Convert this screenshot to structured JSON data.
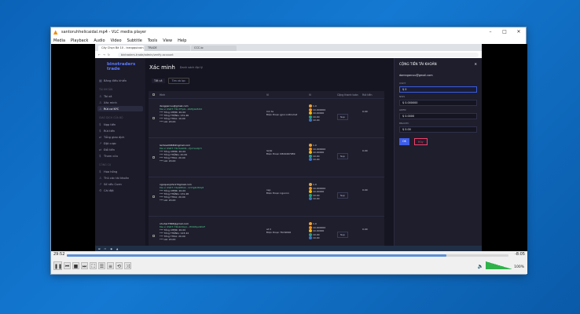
{
  "vlc": {
    "title": "santoruhhelicaidal.mp4 - VLC media player",
    "menu": [
      "Media",
      "Playback",
      "Audio",
      "Video",
      "Subtitle",
      "Tools",
      "View",
      "Help"
    ],
    "time_elapsed": "29:52",
    "time_remaining": "-8:05",
    "progress": 0.86,
    "volume_pct": "100%"
  },
  "browser": {
    "tabs": [
      "Cây Chọn Bà 10 - trangquicoin",
      "TRADE",
      "CCC.io"
    ],
    "url": "bintraders.trade/admin/verify-account"
  },
  "app": {
    "brand": "binotraders trade",
    "sidebar": {
      "dashboard": "Bảng điều khiển",
      "section_account": "TÀI KHOẢN",
      "items_account": [
        "Tài xã",
        "Xác minh",
        "Rút cơ KYC"
      ],
      "section_fin": "GIAO DỊCH CỦA BỘ",
      "items_fin": [
        "Nạp tiền",
        "Rút tiền",
        "Tổng giao dịch",
        "Đặt cược",
        "Đổi tiền",
        "Tham cứu"
      ],
      "section_tools": "CÔNG CỤ",
      "items_tools": [
        "Hoa hồng",
        "Thủ các tài khoản",
        "Số nếu Cuen",
        "Cài đặt"
      ]
    },
    "page_title": "Xác minh",
    "breadcrumb": "Danh sách đại lý",
    "filter_label": "Tất cả",
    "filter_button": "Tìm và lọc",
    "table": {
      "headers": [
        "Hình",
        "Ví",
        "Vi",
        "Cộng thanh toán",
        "Rút tiền"
      ],
      "rows": [
        {
          "email": "dangqarcuu@gmail.com",
          "addr": "Ma ví USDT: T4n7fYp6...K6HJ4LM2tX",
          "lines": [
            "*** Tổng CHĐR: 20.00",
            "*** Tổng THẮNG: 131.46",
            "*** Tổng THUA: 10.00",
            "*** Lãi: 20.00"
          ],
          "name": "Cm ta",
          "phone": "Điện thoại: gpvr.onltcuhat",
          "coins": [
            "1.0",
            "10.000000",
            "10.00000",
            "10.00",
            "10.00"
          ],
          "cong": "Nạp",
          "rut": "0.00"
        },
        {
          "email": "lanhoai0968dmgmail.com",
          "addr": "Ma ví USDT: T4c5aGhR...2JoYxw9jr3",
          "lines": [
            "*** Tổng CHĐR: 20.00",
            "*** Tổng THẮNG: 20.00",
            "*** Tổng THUA: 20.00",
            "*** Lãi: 20.00"
          ],
          "name": "lanbi",
          "phone": "Điện thoại: 0844467989",
          "coins": [
            "1.0",
            "10.000000",
            "10.00000",
            "10.00",
            "10.00"
          ],
          "cong": "Nạp",
          "rut": "0.00"
        },
        {
          "email": "ngoqusnjoho172gmail.com",
          "addr": "Ma ví USDT: T4a98fQ2...VnHg4nB3q8",
          "lines": [
            "*** Tổng CHĐR: 20.00",
            "*** Tổng THẮNG: 131.48",
            "*** Tổng THUA: 20.00",
            "*** Lãi: 20.00"
          ],
          "name": "nsp",
          "phone": "Điện thoại: ngunnn",
          "coins": [
            "1.0",
            "10.000000",
            "10.00000",
            "10.00",
            "10.00"
          ],
          "cong": "Nạp",
          "rut": "0.00"
        },
        {
          "email": "nhuhar7848@gmail.com",
          "addr": "Ma ví USDT: T4b2mKq1...Hh6Wpx9D2f",
          "lines": [
            "*** Tổng CHĐR: 20.00",
            "*** Tổng THẮNG: 123.44",
            "*** Tổng THUA: 20.00",
            "*** Lãi: 20.00"
          ],
          "name": "at ll",
          "phone": "Điện thoại: Ttnt9096",
          "coins": [
            "1.0",
            "10.000000",
            "10.00000",
            "10.00",
            "10.00"
          ],
          "cong": "Nạp",
          "rut": "0.00"
        }
      ]
    },
    "drawer": {
      "title": "CỘNG TIỀN TÀI KHOẢN",
      "email": "damngarcuu@gmail.com",
      "labels": [
        "USDT",
        "NWS",
        "ADEN",
        "BNANTC"
      ],
      "values": [
        "0",
        "0.000000",
        "0.0000",
        "0.00"
      ],
      "ok": "OK",
      "cancel": "Hủy"
    }
  },
  "colors": {
    "accent": "#3e5ee8",
    "green": "#50cd89",
    "yellow": "#ffc700",
    "danger": "#f1416c",
    "coin_colors": [
      "#e8a33d",
      "#f7931a",
      "#f0b90b",
      "#26a17b",
      "#3e73c4"
    ]
  }
}
